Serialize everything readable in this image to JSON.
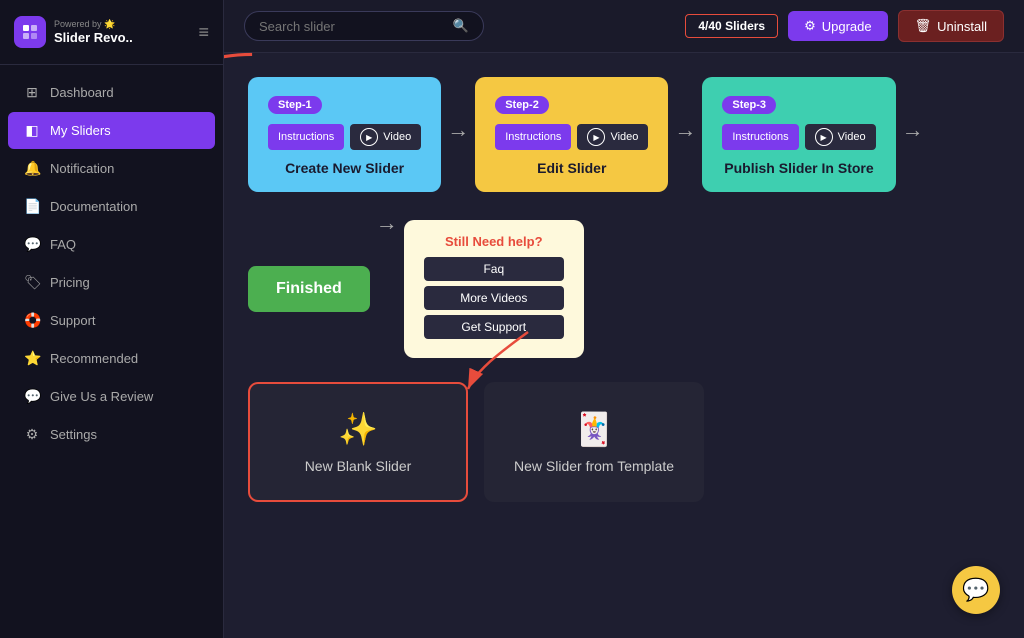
{
  "sidebar": {
    "powered_by": "Powered by 🌟",
    "app_name": "Slider Revo..",
    "nav": [
      {
        "id": "dashboard",
        "icon": "⊞",
        "label": "Dashboard"
      },
      {
        "id": "my-sliders",
        "icon": "◧",
        "label": "My Sliders",
        "active": true
      },
      {
        "id": "notification",
        "icon": "🔔",
        "label": "Notification"
      },
      {
        "id": "documentation",
        "icon": "📄",
        "label": "Documentation"
      },
      {
        "id": "faq",
        "icon": "💬",
        "label": "FAQ"
      },
      {
        "id": "pricing",
        "icon": "🏷",
        "label": "Pricing"
      },
      {
        "id": "support",
        "icon": "🛟",
        "label": "Support"
      },
      {
        "id": "recommended",
        "icon": "⭐",
        "label": "Recommended"
      },
      {
        "id": "give-review",
        "icon": "💬",
        "label": "Give Us a Review"
      },
      {
        "id": "settings",
        "icon": "⚙",
        "label": "Settings"
      }
    ]
  },
  "header": {
    "search_placeholder": "Search slider",
    "slider_count": "4/40 Sliders",
    "upgrade_label": "Upgrade",
    "uninstall_label": "Uninstall"
  },
  "steps": [
    {
      "badge": "Step-1",
      "instructions_label": "Instructions",
      "video_label": "Video",
      "title": "Create New Slider"
    },
    {
      "badge": "Step-2",
      "instructions_label": "Instructions",
      "video_label": "Video",
      "title": "Edit Slider"
    },
    {
      "badge": "Step-3",
      "instructions_label": "Instructions",
      "video_label": "Video",
      "title": "Publish Slider In Store"
    }
  ],
  "finished": {
    "label": "Finished"
  },
  "help": {
    "title": "Still Need help?",
    "faq_label": "Faq",
    "more_videos_label": "More Videos",
    "get_support_label": "Get Support"
  },
  "slider_options": [
    {
      "id": "blank",
      "label": "New Blank Slider",
      "icon": "✨",
      "highlighted": true
    },
    {
      "id": "template",
      "label": "New Slider from Template",
      "icon": "🃏",
      "highlighted": false
    }
  ],
  "chat": {
    "icon": "💬"
  }
}
